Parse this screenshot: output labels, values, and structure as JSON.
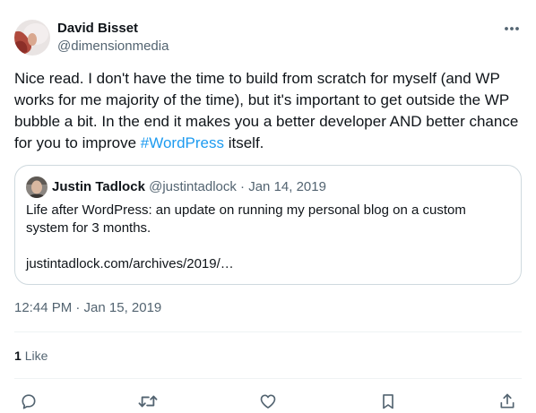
{
  "tweet": {
    "author": {
      "name": "David Bisset",
      "handle": "@dimensionmedia"
    },
    "text_before": "Nice read. I don't have the time to build from scratch for myself (and WP works for me majority of the time), but it's important to get outside the WP bubble a bit. In the end it makes you a better developer AND better chance for you to improve ",
    "hashtag": "#WordPress",
    "text_after": " itself.",
    "quoted": {
      "name": "Justin Tadlock",
      "handle": "@justintadlock",
      "separator": " · ",
      "date": "Jan 14, 2019",
      "text": "Life after WordPress: an update on running my personal blog on a custom system for 3 months.",
      "link": "justintadlock.com/archives/2019/…"
    },
    "timestamp": "12:44 PM · Jan 15, 2019",
    "likes": {
      "count": "1",
      "label": "Like"
    }
  },
  "icons": {
    "more": "more-horizontal-icon",
    "reply": "reply-icon",
    "retweet": "retweet-icon",
    "like": "heart-icon",
    "bookmark": "bookmark-icon",
    "share": "share-icon"
  },
  "colors": {
    "text": "#0f1419",
    "secondary": "#536471",
    "link": "#1d9bf0",
    "border": "#cfd9de",
    "divider": "#eff3f4"
  }
}
